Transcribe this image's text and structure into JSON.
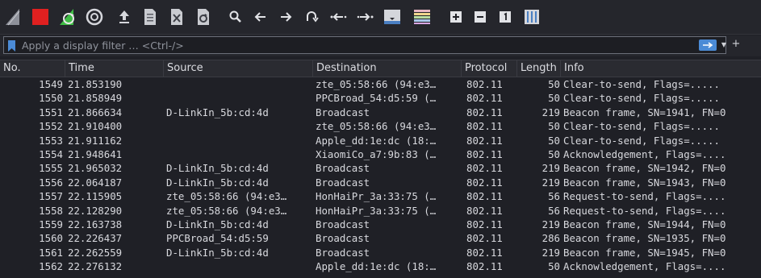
{
  "toolbar": {
    "buttons": [
      {
        "name": "start-capture-icon",
        "icon": "shark-fin"
      },
      {
        "name": "stop-capture-icon",
        "icon": "stop"
      },
      {
        "name": "restart-capture-icon",
        "icon": "restart"
      },
      {
        "name": "capture-options-icon",
        "icon": "gear"
      },
      {
        "name": "open-file-icon",
        "icon": "open"
      },
      {
        "name": "save-file-icon",
        "icon": "save"
      },
      {
        "name": "close-file-icon",
        "icon": "close"
      },
      {
        "name": "reload-file-icon",
        "icon": "reload"
      },
      {
        "name": "find-packet-icon",
        "icon": "search"
      },
      {
        "name": "go-back-icon",
        "icon": "arrow-left"
      },
      {
        "name": "go-forward-icon",
        "icon": "arrow-right"
      },
      {
        "name": "go-to-packet-icon",
        "icon": "goto"
      },
      {
        "name": "first-packet-icon",
        "icon": "first"
      },
      {
        "name": "last-packet-icon",
        "icon": "last"
      },
      {
        "name": "auto-scroll-icon",
        "icon": "autoscroll"
      },
      {
        "name": "colorize-icon",
        "icon": "colorize"
      },
      {
        "name": "zoom-in-icon",
        "icon": "zoom-in"
      },
      {
        "name": "zoom-out-icon",
        "icon": "zoom-out"
      },
      {
        "name": "normal-size-icon",
        "icon": "normal-size"
      },
      {
        "name": "resize-columns-icon",
        "icon": "resize-columns"
      }
    ]
  },
  "filter": {
    "placeholder": "Apply a display filter … <Ctrl-/>"
  },
  "table": {
    "columns": [
      "No.",
      "Time",
      "Source",
      "Destination",
      "Protocol",
      "Length",
      "Info"
    ],
    "rows": [
      {
        "no": "1549",
        "time": "21.853190",
        "source": "",
        "destination": "zte_05:58:66 (94:e3…",
        "protocol": "802.11",
        "length": "50",
        "info": "Clear-to-send, Flags=....."
      },
      {
        "no": "1550",
        "time": "21.858949",
        "source": "",
        "destination": "PPCBroad_54:d5:59 (…",
        "protocol": "802.11",
        "length": "50",
        "info": "Clear-to-send, Flags=....."
      },
      {
        "no": "1551",
        "time": "21.866634",
        "source": "D-LinkIn_5b:cd:4d",
        "destination": "Broadcast",
        "protocol": "802.11",
        "length": "219",
        "info": "Beacon frame, SN=1941, FN=0"
      },
      {
        "no": "1552",
        "time": "21.910400",
        "source": "",
        "destination": "zte_05:58:66 (94:e3…",
        "protocol": "802.11",
        "length": "50",
        "info": "Clear-to-send, Flags=....."
      },
      {
        "no": "1553",
        "time": "21.911162",
        "source": "",
        "destination": "Apple_dd:1e:dc (18:…",
        "protocol": "802.11",
        "length": "50",
        "info": "Clear-to-send, Flags=....."
      },
      {
        "no": "1554",
        "time": "21.948641",
        "source": "",
        "destination": "XiaomiCo_a7:9b:83 (…",
        "protocol": "802.11",
        "length": "50",
        "info": "Acknowledgement, Flags=...."
      },
      {
        "no": "1555",
        "time": "21.965032",
        "source": "D-LinkIn_5b:cd:4d",
        "destination": "Broadcast",
        "protocol": "802.11",
        "length": "219",
        "info": "Beacon frame, SN=1942, FN=0"
      },
      {
        "no": "1556",
        "time": "22.064187",
        "source": "D-LinkIn_5b:cd:4d",
        "destination": "Broadcast",
        "protocol": "802.11",
        "length": "219",
        "info": "Beacon frame, SN=1943, FN=0"
      },
      {
        "no": "1557",
        "time": "22.115905",
        "source": "zte_05:58:66 (94:e3…",
        "destination": "HonHaiPr_3a:33:75 (…",
        "protocol": "802.11",
        "length": "56",
        "info": "Request-to-send, Flags=...."
      },
      {
        "no": "1558",
        "time": "22.128290",
        "source": "zte_05:58:66 (94:e3…",
        "destination": "HonHaiPr_3a:33:75 (…",
        "protocol": "802.11",
        "length": "56",
        "info": "Request-to-send, Flags=...."
      },
      {
        "no": "1559",
        "time": "22.163738",
        "source": "D-LinkIn_5b:cd:4d",
        "destination": "Broadcast",
        "protocol": "802.11",
        "length": "219",
        "info": "Beacon frame, SN=1944, FN=0"
      },
      {
        "no": "1560",
        "time": "22.226437",
        "source": "PPCBroad_54:d5:59",
        "destination": "Broadcast",
        "protocol": "802.11",
        "length": "286",
        "info": "Beacon frame, SN=1935, FN=0"
      },
      {
        "no": "1561",
        "time": "22.262559",
        "source": "D-LinkIn_5b:cd:4d",
        "destination": "Broadcast",
        "protocol": "802.11",
        "length": "219",
        "info": "Beacon frame, SN=1945, FN=0"
      },
      {
        "no": "1562",
        "time": "22.276132",
        "source": "",
        "destination": "Apple_dd:1e:dc (18:…",
        "protocol": "802.11",
        "length": "50",
        "info": "Acknowledgement, Flags=...."
      }
    ]
  },
  "colors": {
    "background": "#1f2026",
    "row_text": "#d8d9de",
    "stop_red": "#e02020",
    "shark_green": "#3fbd45",
    "apply_blue": "#4b8bd6"
  }
}
